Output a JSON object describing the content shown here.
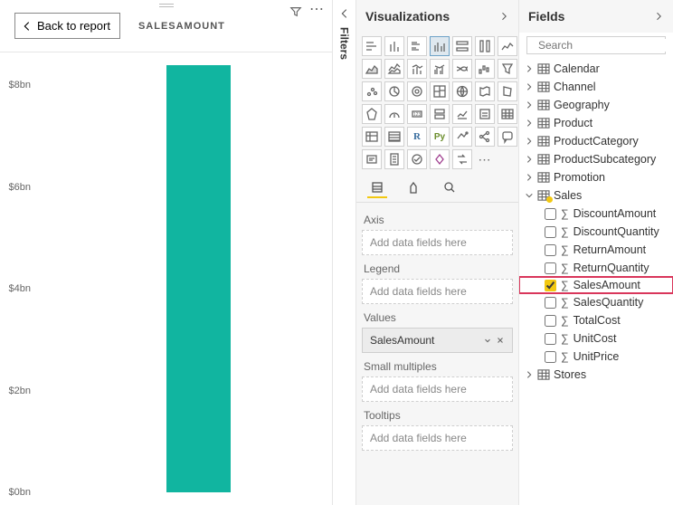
{
  "chart": {
    "back_label": "Back to report",
    "title": "SALESAMOUNT"
  },
  "chart_data": {
    "type": "bar",
    "title": "SALESAMOUNT",
    "categories": [
      ""
    ],
    "values": [
      8400000000
    ],
    "xlabel": "",
    "ylabel": "",
    "ylim": [
      0,
      8000000000
    ],
    "yticks": [
      0,
      2000000000,
      4000000000,
      6000000000,
      8000000000
    ],
    "ytick_labels": [
      "$0bn",
      "$2bn",
      "$4bn",
      "$6bn",
      "$8bn"
    ]
  },
  "filters": {
    "label": "Filters"
  },
  "viz": {
    "header": "Visualizations",
    "wells": {
      "axis": {
        "label": "Axis",
        "placeholder": "Add data fields here"
      },
      "legend": {
        "label": "Legend",
        "placeholder": "Add data fields here"
      },
      "values": {
        "label": "Values",
        "item": "SalesAmount"
      },
      "small": {
        "label": "Small multiples",
        "placeholder": "Add data fields here"
      },
      "tooltips": {
        "label": "Tooltips",
        "placeholder": "Add data fields here"
      }
    }
  },
  "fields": {
    "header": "Fields",
    "search_placeholder": "Search",
    "tables": [
      {
        "name": "Calendar"
      },
      {
        "name": "Channel"
      },
      {
        "name": "Geography"
      },
      {
        "name": "Product"
      },
      {
        "name": "ProductCategory"
      },
      {
        "name": "ProductSubcategory"
      },
      {
        "name": "Promotion"
      },
      {
        "name": "Sales",
        "expanded": true,
        "hasUsed": true,
        "fields": [
          {
            "name": "DiscountAmount"
          },
          {
            "name": "DiscountQuantity"
          },
          {
            "name": "ReturnAmount"
          },
          {
            "name": "ReturnQuantity"
          },
          {
            "name": "SalesAmount",
            "checked": true,
            "highlight": true
          },
          {
            "name": "SalesQuantity"
          },
          {
            "name": "TotalCost"
          },
          {
            "name": "UnitCost"
          },
          {
            "name": "UnitPrice"
          }
        ]
      },
      {
        "name": "Stores"
      }
    ]
  }
}
